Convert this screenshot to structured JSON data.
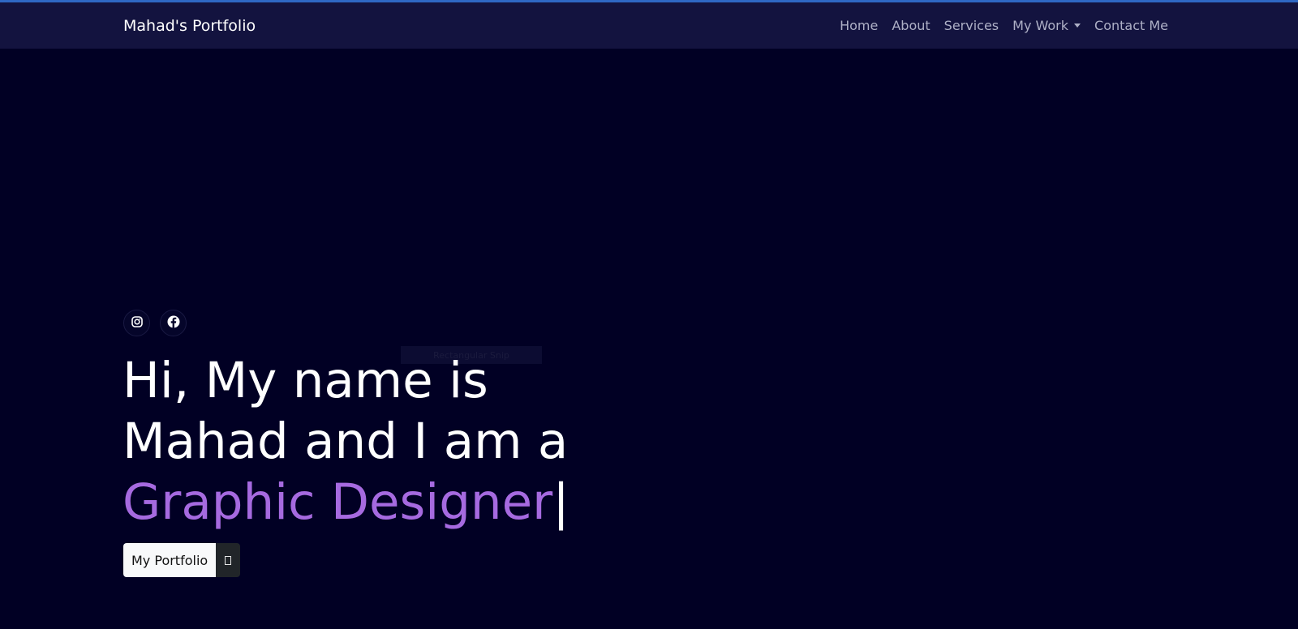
{
  "navbar": {
    "brand": "Mahad's Portfolio",
    "links": [
      "Home",
      "About",
      "Services",
      "My Work",
      "Contact Me"
    ]
  },
  "social": {
    "icons": [
      "instagram-icon",
      "facebook-icon"
    ]
  },
  "tooltip": "Rectangular Snip",
  "hero": {
    "line1": "Hi, My name is",
    "line2": "Mahad and I am a",
    "typed": "Graphic Designer",
    "cursor": "|"
  },
  "buttons": {
    "portfolio": "My Portfolio",
    "secondary_icon": "box-icon"
  },
  "colors": {
    "background": "#010024",
    "navbar": "#13133f",
    "accent": "#a66ae0",
    "nav_text": "#aeb0c6"
  }
}
